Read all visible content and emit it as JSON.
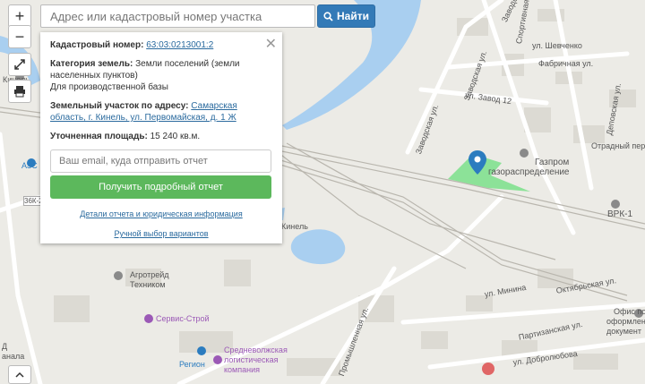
{
  "controls": {
    "zoom_in": "+",
    "zoom_out": "−"
  },
  "search": {
    "placeholder": "Адрес или кадастровый номер участка",
    "button_label": "Найти"
  },
  "panel": {
    "cadastral_label": "Кадастровый номер:",
    "cadastral_value": "63:03:0213001:2",
    "category_label": "Категория земель:",
    "category_value": "Земли поселений (земли населенных пунктов)",
    "category_purpose": "Для производственной базы",
    "address_label": "Земельный участок по адресу:",
    "address_value": "Самарская область, г. Кинель, ул. Первомайская, д. 1 Ж",
    "area_label": "Уточненная площадь:",
    "area_value": "15 240 кв.м.",
    "email_placeholder": "Ваш email, куда отправить отчет",
    "report_button": "Получить подробный отчет",
    "details_link": "Детали отчета и юридическая информация",
    "manual_link": "Ручной выбор вариантов"
  },
  "map_labels": {
    "zavodskaya_top": "Заводская",
    "sportivnaya": "Спортивная ул.",
    "shevchenko": "ул. Шевченко",
    "fabrichnaya": "Фабричная ул.",
    "zavodskaya_ul": "Заводская ул.",
    "zavod12": "ул. Завод 12",
    "depovskaya": "Деповская ул.",
    "otradny": "Отрадный пер.",
    "gazprom": "Газпром",
    "gazoraspredelenie": "газораспределение",
    "vrk": "ВРК-1",
    "kinel_left": "Кинель",
    "azs": "АЗС",
    "road36k": "36К-2",
    "kinel_mid": "Кинель",
    "agrotreid": "Агротрейд",
    "technikum": "Техником",
    "servis_stroy": "Сервис-Строй",
    "srednevolzh1": "Средневолжская",
    "srednevolzh2": "логистическая",
    "srednevolzh3": "компания",
    "region": "Регион",
    "minina": "ул. Минина",
    "oktyabrskaya": "Октябрьская ул.",
    "partizanskaya": "Партизанская ул.",
    "dobrolyubova": "ул. Добролюбова",
    "promyshlennaya": "Промышленная ул.",
    "ofis1": "Офис по",
    "ofis2": "оформлен",
    "ofis3": "документ",
    "d": "Д",
    "kanala": "анала"
  }
}
